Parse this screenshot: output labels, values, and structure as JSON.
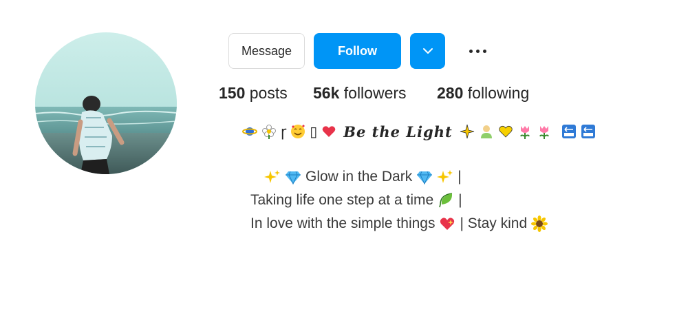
{
  "profile": {
    "avatar_icon": "profile-photo-beach",
    "actions": {
      "message_label": "Message",
      "follow_label": "Follow",
      "dropdown_icon": "chevron-down-icon",
      "more_icon": "more-options-icon"
    },
    "stats": {
      "posts_count": "150",
      "posts_label": "posts",
      "followers_count": "56k",
      "followers_label": "followers",
      "following_count": "280",
      "following_label": "following"
    },
    "name_line": {
      "prefix_glyph": "ɼ",
      "name": "Be the Light",
      "missing_glyph": "▯",
      "emojis": [
        "planet-icon",
        "flower-icon",
        "smiling-hearts-face-icon",
        "heart-icon",
        "sparkle-icon",
        "person-icon",
        "yellow-heart-icon",
        "tulip-icon",
        "tulip-icon",
        "back-arrow-icon",
        "back-arrow-icon"
      ]
    },
    "bio": {
      "line1": "Glow in the Dark",
      "line1_sep": "|",
      "line2": "Taking life one step at a time",
      "line2_sep": "|",
      "line3a": "In love with the simple things",
      "line3b": "| Stay kind"
    }
  },
  "colors": {
    "primary": "#0095f6",
    "text": "#262626",
    "border": "#dbdbdb"
  }
}
